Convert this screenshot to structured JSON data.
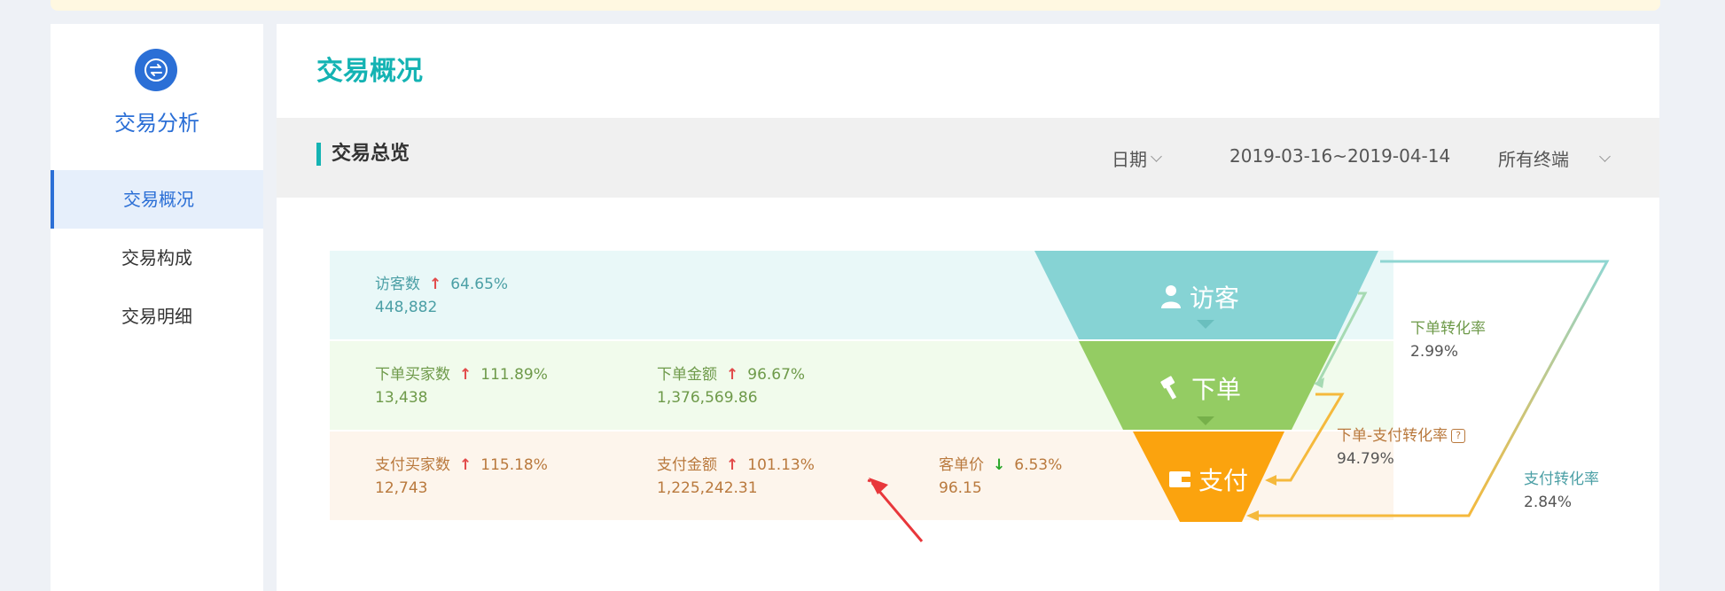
{
  "sidebar": {
    "logo_icon": "exchange-icon",
    "title": "交易分析",
    "items": [
      {
        "label": "交易概况",
        "active": true
      },
      {
        "label": "交易构成",
        "active": false
      },
      {
        "label": "交易明细",
        "active": false
      }
    ]
  },
  "main": {
    "page_title": "交易概况",
    "section_title": "交易总览",
    "filters": {
      "date_label": "日期",
      "date_range": "2019-03-16~2019-04-14",
      "terminal_label": "所有终端"
    }
  },
  "metrics": {
    "visitors": {
      "label": "访客数",
      "change": "64.65%",
      "value": "448,882"
    },
    "order_buyers": {
      "label": "下单买家数",
      "change": "111.89%",
      "value": "13,438"
    },
    "order_amount": {
      "label": "下单金额",
      "change": "96.67%",
      "value": "1,376,569.86"
    },
    "pay_buyers": {
      "label": "支付买家数",
      "change": "115.18%",
      "value": "12,743"
    },
    "pay_amount": {
      "label": "支付金额",
      "change": "101.13%",
      "value": "1,225,242.31"
    },
    "avg_price": {
      "label": "客单价",
      "change": "6.53%",
      "value": "96.15"
    }
  },
  "funnel": {
    "stages": [
      {
        "label": "访客",
        "icon": "user-icon",
        "color": "#86d3d4"
      },
      {
        "label": "下单",
        "icon": "hammer-icon",
        "color": "#94cc63"
      },
      {
        "label": "支付",
        "icon": "wallet-icon",
        "color": "#fba30e"
      }
    ],
    "rates": {
      "order_rate": {
        "label": "下单转化率",
        "value": "2.99%"
      },
      "order_pay_rate": {
        "label": "下单-支付转化率",
        "value": "94.79%"
      },
      "pay_rate": {
        "label": "支付转化率",
        "value": "2.84%"
      }
    }
  },
  "colors": {
    "accent": "#14b3b3",
    "brand": "#2b6fd6",
    "up": "#e24a4a",
    "down": "#2aa72a",
    "annotation": "#e8373b"
  }
}
